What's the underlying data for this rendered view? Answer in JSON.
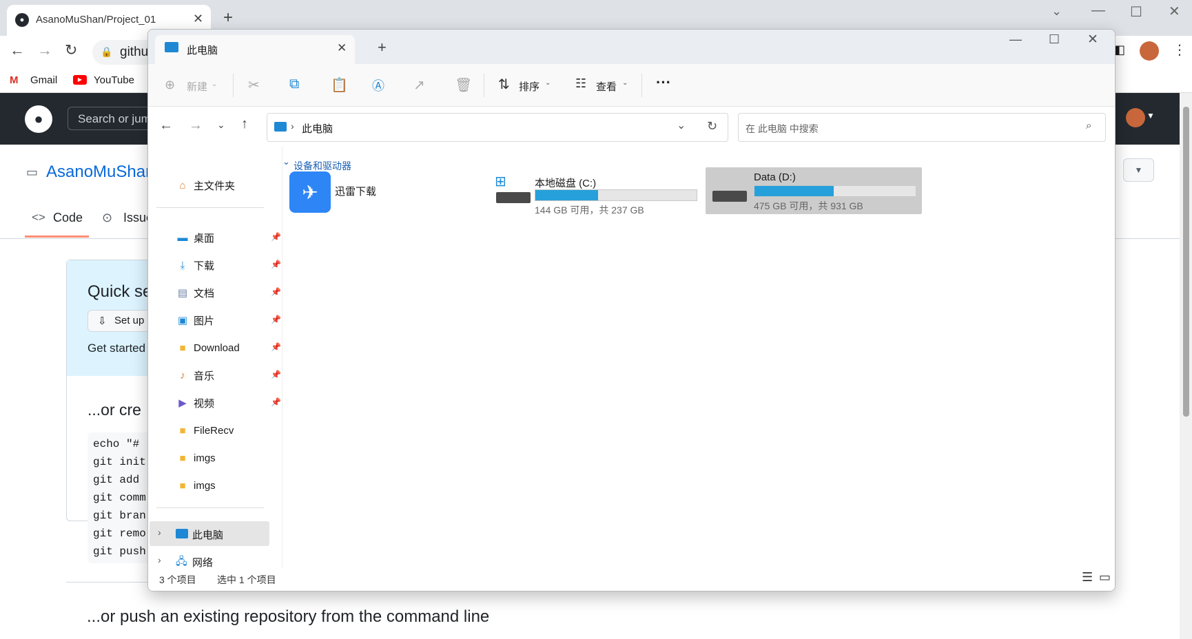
{
  "chrome": {
    "tab_title": "AsanoMuShan/Project_01",
    "url_partial": "githu",
    "bookmarks": [
      {
        "label": "Gmail"
      },
      {
        "label": "YouTube"
      }
    ]
  },
  "github": {
    "search_placeholder": "Search or jum",
    "repo_name": "AsanoMuShan",
    "tabs": {
      "code": "Code",
      "issues": "Issue"
    },
    "quick_setup_title": "Quick se",
    "setup_button": "Set up",
    "get_started": "Get started",
    "create_heading": "...or cre",
    "code_lines": [
      "echo \"#",
      "git init",
      "git add",
      "git comm",
      "git bran",
      "git remo",
      "git push"
    ],
    "push_heading": "...or push an existing repository from the command line"
  },
  "explorer": {
    "tab_title": "此电脑",
    "commands": {
      "new": "新建",
      "sort": "排序",
      "view": "查看"
    },
    "address": "此电脑",
    "search_placeholder": "在 此电脑 中搜索",
    "nav": {
      "home": "主文件夹",
      "quick": [
        {
          "label": "桌面",
          "icon": "desktop-icon",
          "pinned": true
        },
        {
          "label": "下载",
          "icon": "download-icon",
          "pinned": true
        },
        {
          "label": "文档",
          "icon": "document-icon",
          "pinned": true
        },
        {
          "label": "图片",
          "icon": "pictures-icon",
          "pinned": true
        },
        {
          "label": "Download",
          "icon": "folder-icon",
          "pinned": true
        },
        {
          "label": "音乐",
          "icon": "music-icon",
          "pinned": true
        },
        {
          "label": "视频",
          "icon": "video-icon",
          "pinned": true
        },
        {
          "label": "FileRecv",
          "icon": "folder-icon",
          "pinned": false
        },
        {
          "label": "imgs",
          "icon": "folder-icon",
          "pinned": false
        },
        {
          "label": "imgs",
          "icon": "folder-icon",
          "pinned": false
        }
      ],
      "this_pc": "此电脑",
      "network": "网络"
    },
    "section_title": "设备和驱动器",
    "items": {
      "xunlei": "迅雷下载",
      "drive_c": {
        "name": "本地磁盘 (C:)",
        "info": "144 GB 可用，共 237 GB",
        "used_fraction": 0.39
      },
      "drive_d": {
        "name": "Data (D:)",
        "info": "475 GB 可用，共 931 GB",
        "used_fraction": 0.49
      }
    },
    "status": {
      "count": "3 个项目",
      "selected": "选中 1 个项目"
    }
  },
  "colors": {
    "accent": "#26a0da",
    "gh_header": "#24292f",
    "explorer_selected": "#cce4f7"
  }
}
